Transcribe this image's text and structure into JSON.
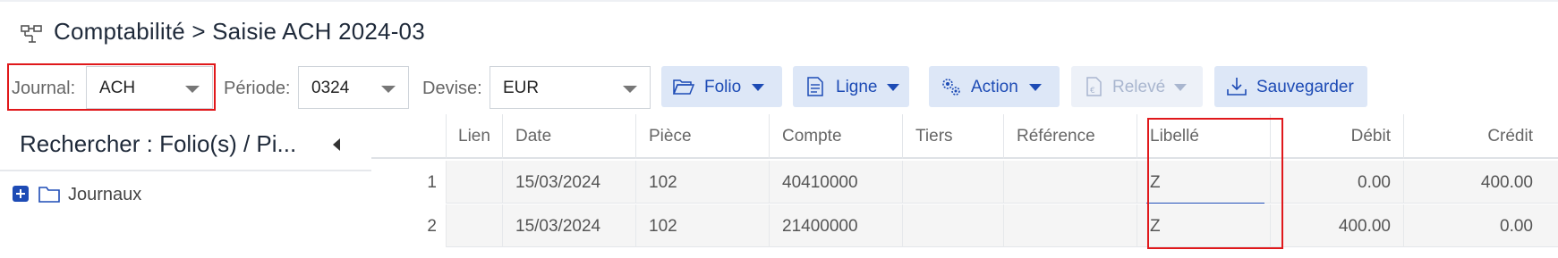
{
  "header": {
    "title": "Comptabilité > Saisie ACH 2024-03",
    "icon": "sitemap-icon"
  },
  "toolbar": {
    "journal": {
      "label": "Journal:",
      "value": "ACH"
    },
    "periode": {
      "label": "Période:",
      "value": "0324"
    },
    "devise": {
      "label": "Devise:",
      "value": "EUR"
    },
    "buttons": {
      "folio": "Folio",
      "ligne": "Ligne",
      "action": "Action",
      "releve": "Relevé",
      "sauvegarder": "Sauvegarder"
    }
  },
  "sidebar": {
    "title": "Rechercher : Folio(s) / Pi...",
    "tree": [
      {
        "label": "Journaux"
      }
    ]
  },
  "grid": {
    "columns": [
      "",
      "Lien",
      "Date",
      "Pièce",
      "Compte",
      "Tiers",
      "Référence",
      "Libellé",
      "Débit",
      "Crédit"
    ],
    "rows": [
      {
        "num": "1",
        "lien": "",
        "date": "15/03/2024",
        "piece": "102",
        "compte": "40410000",
        "tiers": "",
        "reference": "",
        "libelle": "Z",
        "debit": "0.00",
        "credit": "400.00"
      },
      {
        "num": "2",
        "lien": "",
        "date": "15/03/2024",
        "piece": "102",
        "compte": "21400000",
        "tiers": "",
        "reference": "",
        "libelle": "Z",
        "debit": "400.00",
        "credit": "0.00"
      }
    ]
  },
  "colors": {
    "accent": "#1d4bb5",
    "highlight": "#e0181b",
    "button_bg": "#dde7f7"
  }
}
